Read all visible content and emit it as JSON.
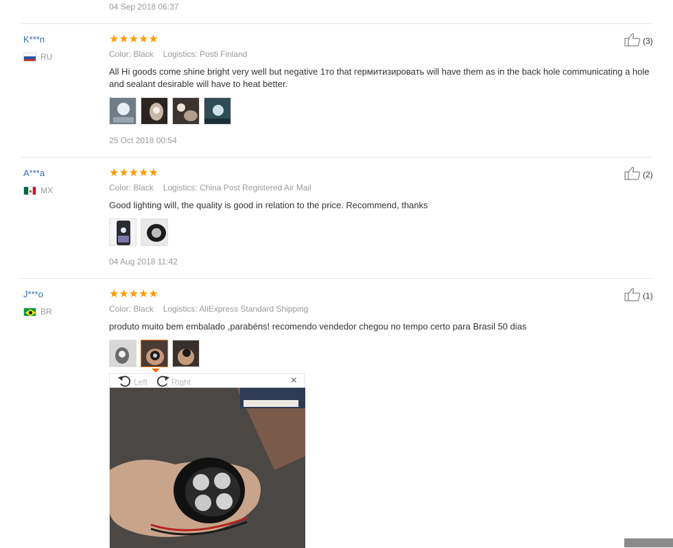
{
  "top_date": "04 Sep 2018 06:37",
  "reviews": [
    {
      "user": "K***n",
      "country": "RU",
      "stars": "★★★★★",
      "color_label": "Color:",
      "color_value": "Black",
      "logistics_label": "Logistics:",
      "logistics_value": "Posti Finland",
      "text": "All Hi goods come shine bright very well but negative 1то that гермитизировать will have them as in the back hole communicating a hole and sealant desirable will have to heat better.",
      "date": "25 Oct 2018 00:54",
      "likes": "(3)"
    },
    {
      "user": "A***a",
      "country": "MX",
      "stars": "★★★★★",
      "color_label": "Color:",
      "color_value": "Black",
      "logistics_label": "Logistics:",
      "logistics_value": "China Post Registered Air Mail",
      "text": "Good lighting will, the quality is good in relation to the price. Recommend, thanks",
      "date": "04 Aug 2018 11:42",
      "likes": "(2)"
    },
    {
      "user": "J***o",
      "country": "BR",
      "stars": "★★★★★",
      "color_label": "Color:",
      "color_value": "Black",
      "logistics_label": "Logistics:",
      "logistics_value": "AliExpress Standard Shipping",
      "text": "produto muito bem embalado ,parabéns! recomendo vendedor chegou no tempo certo para Brasil 50 dias",
      "likes": "(1)"
    }
  ],
  "viewer": {
    "left_label": "Left",
    "right_label": "Right",
    "close": "×"
  },
  "colors": {
    "accent": "#ff6600",
    "star": "#ff9900",
    "link": "#2f6ab1"
  }
}
